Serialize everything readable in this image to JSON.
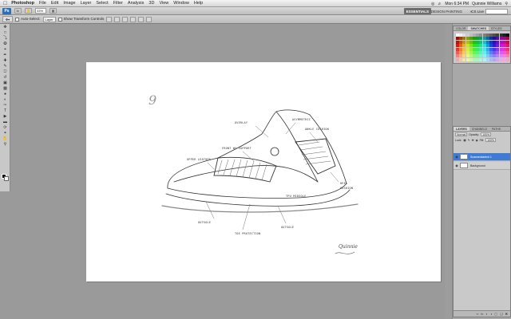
{
  "menubar": {
    "app": "Photoshop",
    "items": [
      "File",
      "Edit",
      "Image",
      "Layer",
      "Select",
      "Filter",
      "Analysis",
      "3D",
      "View",
      "Window",
      "Help"
    ],
    "clock": "Mon 6:34 PM",
    "user": "Quinnie Williams"
  },
  "appbar": {
    "logo": "Ps",
    "zoom": "33%",
    "workspaces": [
      "ESSENTIALS",
      "DESIGN",
      "PAINTING",
      "»"
    ],
    "cs_live": "CS Live"
  },
  "options": {
    "auto_select_label": "Auto-Select:",
    "auto_select_value": "Layer",
    "transform_label": "Show Transform Controls"
  },
  "swatches_panel": {
    "tabs": [
      "COLOR",
      "SWATCHES",
      "STYLES"
    ],
    "active_tab": "SWATCHES"
  },
  "layers_panel": {
    "tabs": [
      "LAYERS",
      "CHANNELS",
      "PATHS"
    ],
    "active_tab": "LAYERS",
    "blend_mode": "Normal",
    "opacity_label": "Opacity:",
    "opacity_value": "100%",
    "lock_label": "Lock:",
    "fill_label": "Fill:",
    "fill_value": "100%",
    "layers": [
      {
        "name": "Scannedsketch 1",
        "selected": true
      },
      {
        "name": "Background",
        "selected": false
      }
    ]
  },
  "sketch": {
    "size_mark": "9",
    "labels": {
      "l1": "OVERLAY",
      "l2": "ASYMMETRIC",
      "l3": "ANKLE CUSHION",
      "l4": "FRONT WY SUPPORT",
      "l5": "UPPER LEATHER",
      "l6": "TPU MIDSOLE",
      "l7": "OUTSOLE",
      "l8": "TOE PROTECTION",
      "l9": "OUTSOLE",
      "l10": "HEEL",
      "l11": "CUSHION"
    },
    "signature": "Quinnie"
  }
}
